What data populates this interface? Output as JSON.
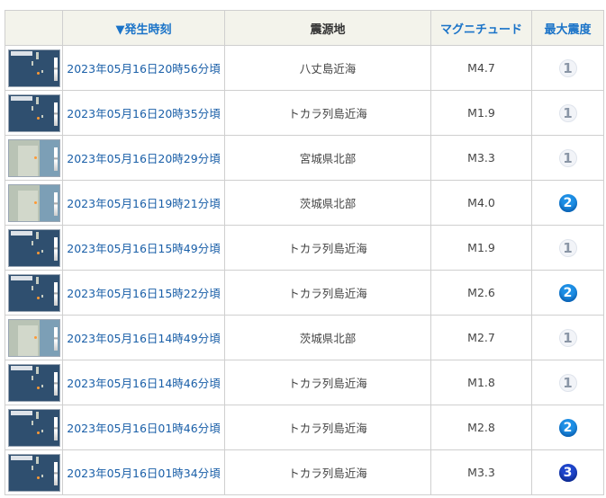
{
  "table": {
    "headers": {
      "image": "",
      "time": "▼発生時刻",
      "epicenter": "震源地",
      "magnitude": "マグニチュード",
      "max_intensity": "最大震度"
    },
    "rows": [
      {
        "time": "2023年05月16日20時56分頃",
        "epicenter": "八丈島近海",
        "magnitude": "M4.7",
        "intensity": "1",
        "map": "sea-map-thumbnail"
      },
      {
        "time": "2023年05月16日20時35分頃",
        "epicenter": "トカラ列島近海",
        "magnitude": "M1.9",
        "intensity": "1",
        "map": "sea-map-thumbnail"
      },
      {
        "time": "2023年05月16日20時29分頃",
        "epicenter": "宮城県北部",
        "magnitude": "M3.3",
        "intensity": "1",
        "map": "land-map-thumbnail"
      },
      {
        "time": "2023年05月16日19時21分頃",
        "epicenter": "茨城県北部",
        "magnitude": "M4.0",
        "intensity": "2",
        "map": "land-map-thumbnail"
      },
      {
        "time": "2023年05月16日15時49分頃",
        "epicenter": "トカラ列島近海",
        "magnitude": "M1.9",
        "intensity": "1",
        "map": "sea-map-thumbnail"
      },
      {
        "time": "2023年05月16日15時22分頃",
        "epicenter": "トカラ列島近海",
        "magnitude": "M2.6",
        "intensity": "2",
        "map": "sea-map-thumbnail"
      },
      {
        "time": "2023年05月16日14時49分頃",
        "epicenter": "茨城県北部",
        "magnitude": "M2.7",
        "intensity": "1",
        "map": "land-map-thumbnail"
      },
      {
        "time": "2023年05月16日14時46分頃",
        "epicenter": "トカラ列島近海",
        "magnitude": "M1.8",
        "intensity": "1",
        "map": "sea-map-thumbnail"
      },
      {
        "time": "2023年05月16日01時46分頃",
        "epicenter": "トカラ列島近海",
        "magnitude": "M2.8",
        "intensity": "2",
        "map": "sea-map-thumbnail"
      },
      {
        "time": "2023年05月16日01時34分頃",
        "epicenter": "トカラ列島近海",
        "magnitude": "M3.3",
        "intensity": "3",
        "map": "sea-map-thumbnail"
      }
    ]
  },
  "colors": {
    "header_bg": "#f3f3eb",
    "link": "#1a5fa8",
    "sort_header": "#1a73c8",
    "intensity_1": "#8a96a6",
    "intensity_2": "#1e90e6",
    "intensity_3": "#1f46cc"
  }
}
